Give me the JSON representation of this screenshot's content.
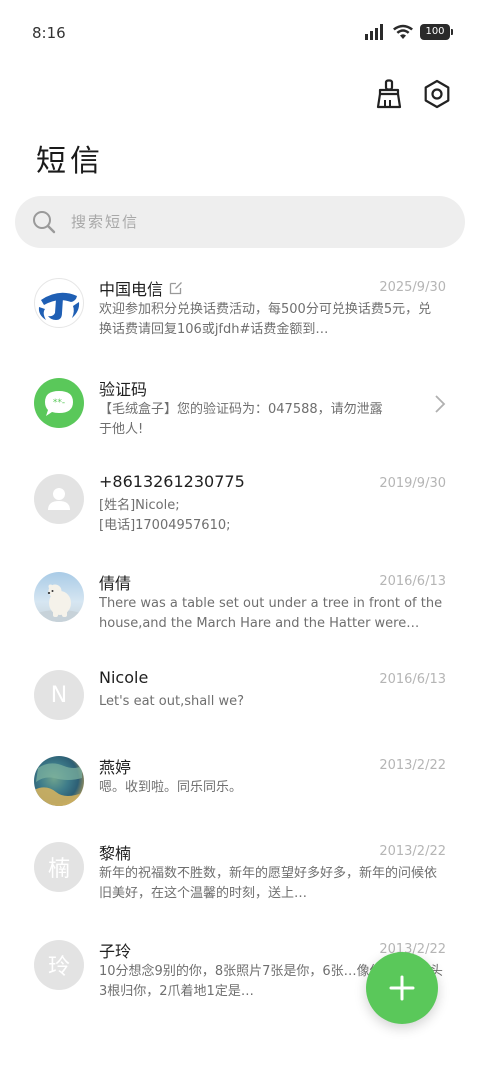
{
  "status": {
    "time": "8:16",
    "battery": "100"
  },
  "header": {
    "title": "短信"
  },
  "search": {
    "placeholder": "搜索短信"
  },
  "messages": [
    {
      "name": "中国电信",
      "date": "2025/9/30",
      "preview": "欢迎参加积分兑换话费活动，每500分可兑换话费5元，兑换话费请回复106或jfdh#话费金额到…",
      "avatar": "china-telecom-logo"
    },
    {
      "name": "验证码",
      "date": "",
      "preview": "【毛绒盒子】您的验证码为：047588，请勿泄露于他人!",
      "avatar": "verification-code-icon"
    },
    {
      "name": "+8613261230775",
      "date": "2019/9/30",
      "preview": "[姓名]Nicole;\n[电话]17004957610;",
      "avatar": "person-icon"
    },
    {
      "name": "倩倩",
      "date": "2016/6/13",
      "preview": "There was a table set out under a tree in front of the house,and the March Hare and the Hatter were having …",
      "avatar": "polar-bear-photo"
    },
    {
      "name": "Nicole",
      "date": "2016/6/13",
      "preview": "Let's eat out,shall we?",
      "avatar_letter": "N"
    },
    {
      "name": "燕婷",
      "date": "2013/2/22",
      "preview": "嗯。收到啦。同乐同乐。",
      "avatar": "landscape-photo"
    },
    {
      "name": "黎楠",
      "date": "2013/2/22",
      "preview": "新年的祝福数不胜数，新年的愿望好多好多，新年的问候依旧美好，在这个温馨的时刻，送上…",
      "avatar_letter": "楠"
    },
    {
      "name": "子玲",
      "date": "2013/2/22",
      "preview": "10分想念9别的你，8张照片7张是你，6张…像你，4根骨头3根归你，2爪着地1定是…",
      "avatar_letter": "玲"
    }
  ],
  "colors": {
    "accent": "#5ac85a",
    "telecom_blue": "#1f5fb4"
  }
}
